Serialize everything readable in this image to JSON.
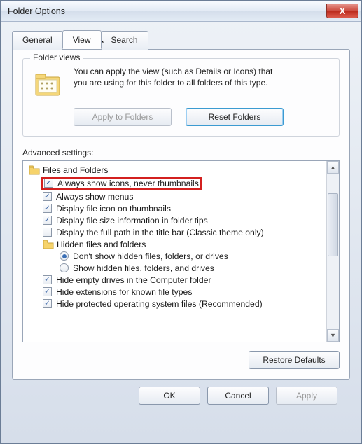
{
  "window": {
    "title": "Folder Options",
    "close": "X"
  },
  "tabs": {
    "general": "General",
    "view": "View",
    "search": "Search"
  },
  "folder_views": {
    "legend": "Folder views",
    "text_line1": "You can apply the view (such as Details or Icons) that",
    "text_line2": "you are using for this folder to all folders of this type.",
    "apply_btn": "Apply to Folders",
    "reset_btn": "Reset Folders"
  },
  "advanced": {
    "label": "Advanced settings:",
    "group_files_folders": "Files and Folders",
    "opt_always_icons": "Always show icons, never thumbnails",
    "opt_always_menus": "Always show menus",
    "opt_file_icon_thumb": "Display file icon on thumbnails",
    "opt_file_size_tips": "Display file size information in folder tips",
    "opt_full_path_title": "Display the full path in the title bar (Classic theme only)",
    "group_hidden": "Hidden files and folders",
    "opt_hidden_dont": "Don't show hidden files, folders, or drives",
    "opt_hidden_show": "Show hidden files, folders, and drives",
    "opt_hide_empty_drives": "Hide empty drives in the Computer folder",
    "opt_hide_ext": "Hide extensions for known file types",
    "opt_hide_protected": "Hide protected operating system files (Recommended)"
  },
  "buttons": {
    "restore": "Restore Defaults",
    "ok": "OK",
    "cancel": "Cancel",
    "apply": "Apply"
  }
}
